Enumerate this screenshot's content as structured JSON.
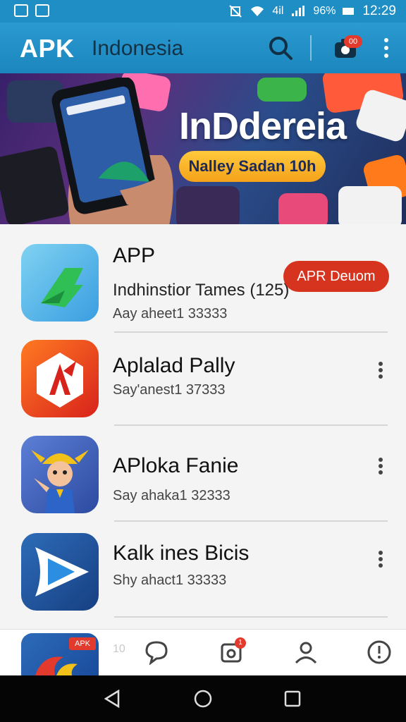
{
  "status_bar": {
    "signal_text": "4il",
    "battery_text": "96%",
    "time": "12:29"
  },
  "app_bar": {
    "brand": "APK",
    "title": "Indonesia",
    "notification_badge": "00"
  },
  "banner": {
    "title": "InDdereia",
    "pill": "Nalley Sadan 10h"
  },
  "apps": [
    {
      "name": "APP",
      "subtitle": "Indhinstior Tames (125)",
      "meta": "Aay aheet1 33333",
      "action": "APR Deuom"
    },
    {
      "name": "Aplalad Pally",
      "meta": "Say'anest1 37333"
    },
    {
      "name": "APloka Fanie",
      "meta": "Say ahaka1 32333"
    },
    {
      "name": "Kalk ines Bicis",
      "meta": "Shy ahact1 33333"
    }
  ],
  "bottom_nav": {
    "peek_badge": "APK",
    "peek_number": "10",
    "inbox_badge": "1"
  },
  "icons": [
    "search-icon",
    "camera-icon",
    "more-vert-icon",
    "chat-icon",
    "inbox-icon",
    "profile-icon",
    "more-circle-icon",
    "back-icon",
    "home-icon",
    "recents-icon"
  ],
  "colors": {
    "primary": "#1f8ec4",
    "accent": "#d7341f",
    "pill": "#f5a21a"
  }
}
